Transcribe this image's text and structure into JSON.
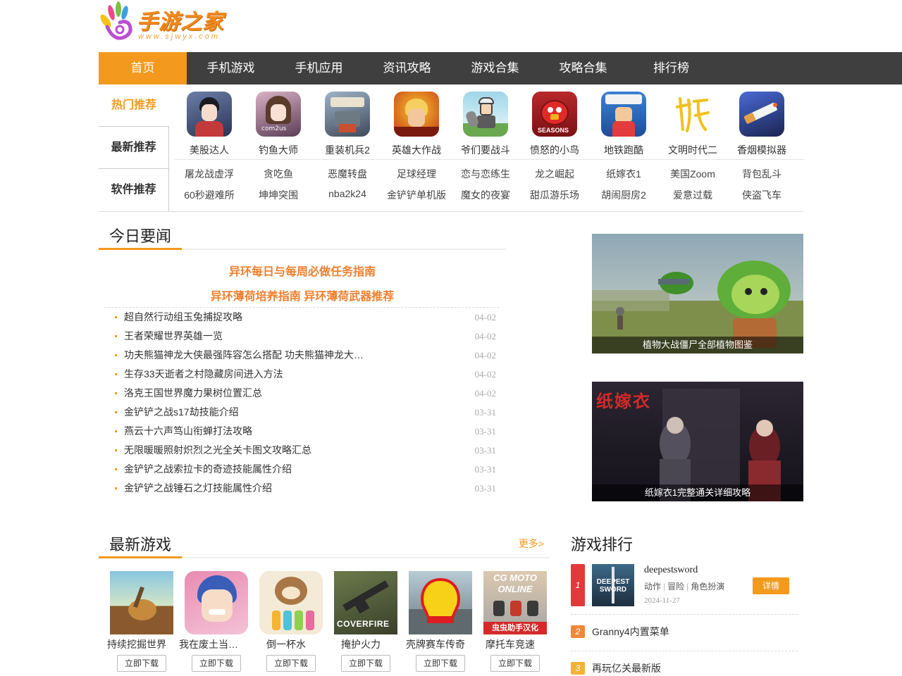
{
  "logo": {
    "text": "手游之家",
    "url_text": "www.sjwyx.com"
  },
  "nav": [
    "首页",
    "手机游戏",
    "手机应用",
    "资讯攻略",
    "游戏合集",
    "攻略合集",
    "排行榜"
  ],
  "recommend": {
    "tabs": [
      "热门推荐",
      "最新推荐",
      "软件推荐"
    ],
    "icons": [
      {
        "label": "美股达人",
        "icon": "anime-boy-icon"
      },
      {
        "label": "钓鱼大师",
        "icon": "anime-girl-icon"
      },
      {
        "label": "重装机兵2",
        "icon": "mech-icon"
      },
      {
        "label": "英雄大作战",
        "icon": "hero-icon"
      },
      {
        "label": "爷们要战斗",
        "icon": "warrior-icon"
      },
      {
        "label": "愤怒的小鸟",
        "icon": "angry-bird-icon"
      },
      {
        "label": "地铁跑酷",
        "icon": "subway-icon"
      },
      {
        "label": "文明时代二",
        "icon": "calligraphy-icon"
      },
      {
        "label": "香烟模拟器",
        "icon": "cigarette-icon"
      }
    ],
    "text_rows": [
      [
        "屠龙战虚浮",
        "贪吃鱼",
        "恶魔转盘",
        "足球经理",
        "恋与恋练生",
        "龙之崛起",
        "纸嫁衣1",
        "美国Zoom",
        "背包乱斗"
      ],
      [
        "60秒避难所",
        "坤坤突围",
        "nba2k24",
        "金铲铲单机版",
        "魔女的夜宴",
        "甜瓜游乐场",
        "胡闹厨房2",
        "爱意过载",
        "侠盗飞车"
      ]
    ]
  },
  "news": {
    "title": "今日要闻",
    "headlines": [
      "异环每日与每周必做任务指南",
      "异环薄荷培养指南 异环薄荷武器推荐"
    ],
    "items": [
      {
        "title": "超自然行动组玉兔捕捉攻略",
        "date": "04-02"
      },
      {
        "title": "王者荣耀世界英雄一览",
        "date": "04-02"
      },
      {
        "title": "功夫熊猫神龙大侠最强阵容怎么搭配 功夫熊猫神龙大侠阵容推荐",
        "date": "04-02"
      },
      {
        "title": "生存33天逝者之村隐藏房间进入方法",
        "date": "04-02"
      },
      {
        "title": "洛克王国世界魔力果树位置汇总",
        "date": "04-02"
      },
      {
        "title": "金铲铲之战s17劫技能介绍",
        "date": "03-31"
      },
      {
        "title": "燕云十六声笃山衔蝉打法攻略",
        "date": "03-31"
      },
      {
        "title": "无限暖暖照射炽烈之光全关卡图文攻略汇总",
        "date": "03-31"
      },
      {
        "title": "金铲铲之战索拉卡的奇迹技能属性介绍",
        "date": "03-31"
      },
      {
        "title": "金铲铲之战锤石之灯技能属性介绍",
        "date": "03-31"
      }
    ]
  },
  "banners": [
    {
      "caption": "植物大战僵尸全部植物图鉴"
    },
    {
      "caption": "纸嫁衣1完整通关详细攻略",
      "art_text": "纸嫁衣"
    }
  ],
  "latest": {
    "title": "最新游戏",
    "more": "更多>",
    "download_label": "立即下载",
    "games": [
      {
        "name": "持续挖掘世界",
        "art": ""
      },
      {
        "name": "我在废土当大王",
        "art": ""
      },
      {
        "name": "倒一杯水",
        "art": ""
      },
      {
        "name": "掩护火力",
        "art": "COVERFIRE"
      },
      {
        "name": "壳牌赛车传奇",
        "art": ""
      },
      {
        "name": "摩托车竞速",
        "art": "CG MOTO ONLINE",
        "badge": "虫虫助手汉化"
      }
    ]
  },
  "ranking": {
    "title": "游戏排行",
    "first": {
      "rank": "1",
      "name": "deepestsword",
      "tags": [
        "动作",
        "冒险",
        "角色扮演"
      ],
      "date": "2024-11-27",
      "detail": "详情",
      "art": "DEEPEST SWORD"
    },
    "others": [
      {
        "rank": "2",
        "name": "Granny4内置菜单",
        "color": "#f0883a"
      },
      {
        "rank": "3",
        "name": "再玩亿关最新版",
        "color": "#f5b335"
      }
    ]
  }
}
